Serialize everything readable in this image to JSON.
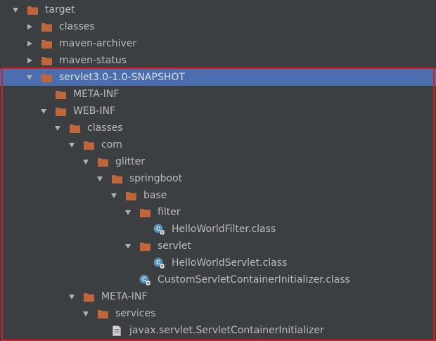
{
  "tree": [
    {
      "label": "target",
      "type": "folder",
      "expand": "down",
      "indent": 0
    },
    {
      "label": "classes",
      "type": "folder",
      "expand": "right",
      "indent": 1
    },
    {
      "label": "maven-archiver",
      "type": "folder",
      "expand": "right",
      "indent": 1
    },
    {
      "label": "maven-status",
      "type": "folder",
      "expand": "right",
      "indent": 1
    },
    {
      "label": "servlet3.0-1.0-SNAPSHOT",
      "type": "folder",
      "expand": "down",
      "indent": 1,
      "selected": true
    },
    {
      "label": "META-INF",
      "type": "folder",
      "expand": "none",
      "indent": 2
    },
    {
      "label": "WEB-INF",
      "type": "folder",
      "expand": "down",
      "indent": 2
    },
    {
      "label": "classes",
      "type": "folder",
      "expand": "down",
      "indent": 3
    },
    {
      "label": "com",
      "type": "folder",
      "expand": "down",
      "indent": 4
    },
    {
      "label": "glitter",
      "type": "folder",
      "expand": "down",
      "indent": 5
    },
    {
      "label": "springboot",
      "type": "folder",
      "expand": "down",
      "indent": 6
    },
    {
      "label": "base",
      "type": "folder",
      "expand": "down",
      "indent": 7
    },
    {
      "label": "filter",
      "type": "folder",
      "expand": "down",
      "indent": 8
    },
    {
      "label": "HelloWorldFilter.class",
      "type": "class",
      "expand": "none",
      "indent": 9
    },
    {
      "label": "servlet",
      "type": "folder",
      "expand": "down",
      "indent": 8
    },
    {
      "label": "HelloWorldServlet.class",
      "type": "class",
      "expand": "none",
      "indent": 9
    },
    {
      "label": "CustomServletContainerInitializer.class",
      "type": "class",
      "expand": "none",
      "indent": 8
    },
    {
      "label": "META-INF",
      "type": "folder",
      "expand": "down",
      "indent": 4
    },
    {
      "label": "services",
      "type": "folder",
      "expand": "down",
      "indent": 5
    },
    {
      "label": "javax.servlet.ServletContainerInitializer",
      "type": "file",
      "expand": "none",
      "indent": 6
    }
  ],
  "colors": {
    "background": "#3c3f41",
    "selection": "#4b6eaf",
    "text": "#bbbbbb",
    "folder": "#c0663a",
    "class_badge": "#4b92c3",
    "highlight_border": "#e01b1b"
  },
  "icons": {
    "folder": "folder-icon",
    "class": "java-class-file-icon",
    "file": "text-file-icon"
  }
}
